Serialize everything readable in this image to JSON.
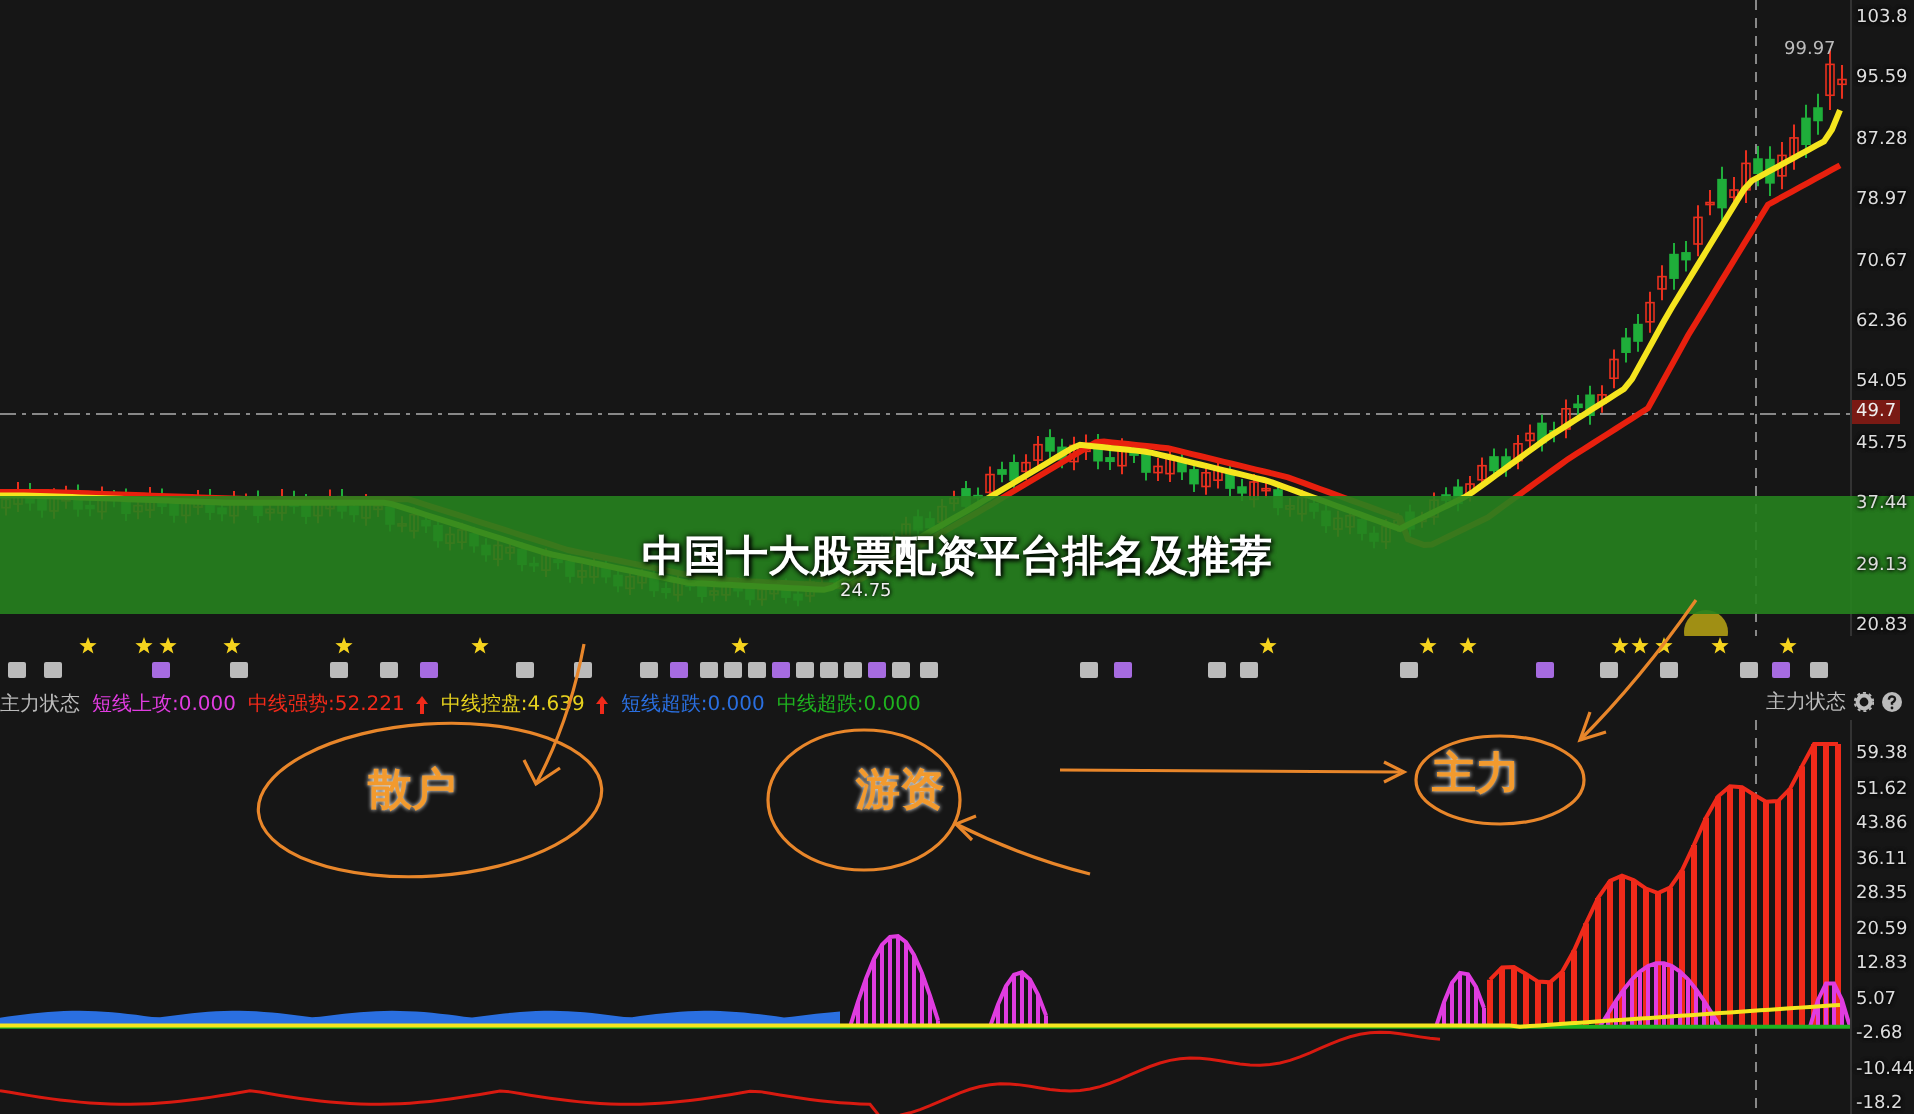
{
  "banner": {
    "title": "中国十大股票配资平台排名及推荐"
  },
  "price_axis": [
    "103.8",
    "95.59",
    "87.28",
    "78.97",
    "70.67",
    "62.36",
    "54.05",
    "45.75",
    "37.44",
    "29.13",
    "20.83"
  ],
  "price_markers": {
    "high": "99.97",
    "low": "24.75",
    "current": "49.7"
  },
  "indicator": {
    "name": "主力状态",
    "readings": [
      {
        "label": "短线上攻:0.000",
        "color": "#e03ce0",
        "rising": false
      },
      {
        "label": "中线强势:52.221",
        "color": "#f02a1a",
        "rising": true
      },
      {
        "label": "中线控盘:4.639",
        "color": "#e6d21e",
        "rising": true
      },
      {
        "label": "短线超跌:0.000",
        "color": "#2a6fe0",
        "rising": false
      },
      {
        "label": "中线超跌:0.000",
        "color": "#1fb21f",
        "rising": false
      }
    ]
  },
  "indicator_panel": {
    "title": "主力状态",
    "axis": [
      "59.38",
      "51.62",
      "43.86",
      "36.11",
      "28.35",
      "20.59",
      "12.83",
      "5.07",
      "-2.68",
      "-10.44",
      "-18.2"
    ]
  },
  "annotations": [
    {
      "text": "散户"
    },
    {
      "text": "游资"
    },
    {
      "text": "主力"
    }
  ]
}
